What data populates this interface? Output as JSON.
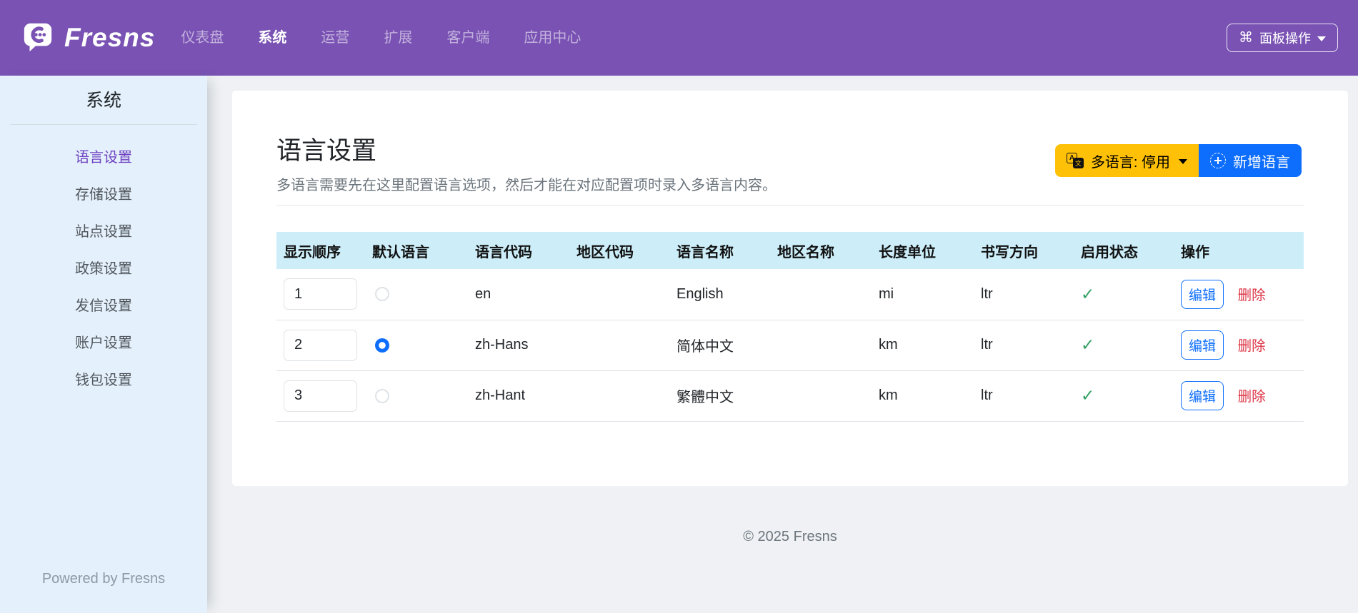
{
  "navbar": {
    "brand": "Fresns",
    "items": [
      {
        "label": "仪表盘",
        "active": false
      },
      {
        "label": "系统",
        "active": true
      },
      {
        "label": "运营",
        "active": false
      },
      {
        "label": "扩展",
        "active": false
      },
      {
        "label": "客户端",
        "active": false
      },
      {
        "label": "应用中心",
        "active": false
      }
    ],
    "panel_button": {
      "icon_glyph": "⌘",
      "label": "面板操作"
    }
  },
  "sidebar": {
    "title": "系统",
    "items": [
      {
        "label": "语言设置",
        "active": true
      },
      {
        "label": "存储设置",
        "active": false
      },
      {
        "label": "站点设置",
        "active": false
      },
      {
        "label": "政策设置",
        "active": false
      },
      {
        "label": "发信设置",
        "active": false
      },
      {
        "label": "账户设置",
        "active": false
      },
      {
        "label": "钱包设置",
        "active": false
      }
    ],
    "powered_by": "Powered by Fresns"
  },
  "page": {
    "title": "语言设置",
    "subtitle": "多语言需要先在这里配置语言选项，然后才能在对应配置项时录入多语言内容。"
  },
  "toolbar": {
    "multilingual_label": "多语言: 停用",
    "translate_icon_a": "A",
    "translate_icon_wen": "文",
    "add_label": "新增语言"
  },
  "table": {
    "headers": [
      "显示顺序",
      "默认语言",
      "语言代码",
      "地区代码",
      "语言名称",
      "地区名称",
      "长度单位",
      "书写方向",
      "启用状态",
      "操作"
    ],
    "rows": [
      {
        "order": "1",
        "default": false,
        "lang_code": "en",
        "area_code": "",
        "lang_name": "English",
        "area_name": "",
        "length_unit": "mi",
        "direction": "ltr",
        "enabled_glyph": "✓",
        "edit": "编辑",
        "delete": "删除"
      },
      {
        "order": "2",
        "default": true,
        "lang_code": "zh-Hans",
        "area_code": "",
        "lang_name": "简体中文",
        "area_name": "",
        "length_unit": "km",
        "direction": "ltr",
        "enabled_glyph": "✓",
        "edit": "编辑",
        "delete": "删除"
      },
      {
        "order": "3",
        "default": false,
        "lang_code": "zh-Hant",
        "area_code": "",
        "lang_name": "繁體中文",
        "area_name": "",
        "length_unit": "km",
        "direction": "ltr",
        "enabled_glyph": "✓",
        "edit": "编辑",
        "delete": "删除"
      }
    ]
  },
  "footer": {
    "copyright": "© 2025 Fresns"
  },
  "colors": {
    "navbar_bg": "#7952b3",
    "sidebar_bg": "#e4f1fc",
    "active_purple": "#6f42c1",
    "primary_blue": "#0d6efd",
    "warning_yellow": "#ffc107",
    "danger_red": "#dc3545",
    "success_green": "#2f9e60",
    "table_header_bg": "#cdeef9"
  }
}
